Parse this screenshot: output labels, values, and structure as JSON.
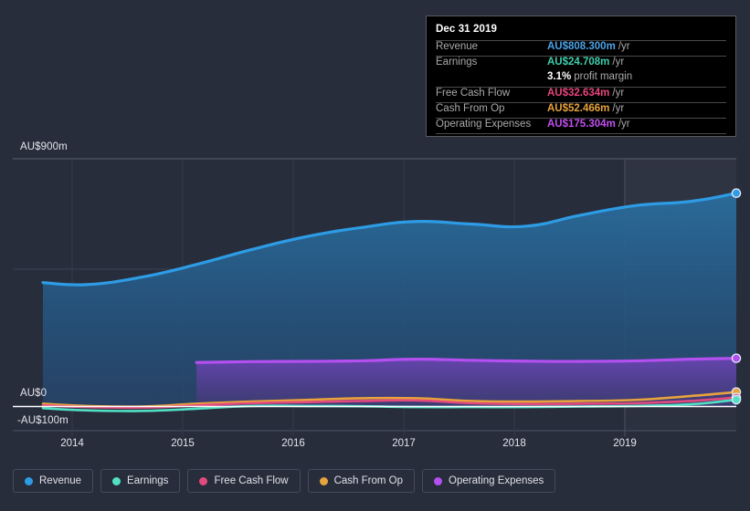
{
  "chart_data": {
    "type": "area",
    "title": "",
    "xlabel": "",
    "ylabel": "",
    "currency": "AU$",
    "x_tick_labels": [
      "2014",
      "2015",
      "2016",
      "2017",
      "2018",
      "2019"
    ],
    "y_tick_labels": [
      "AU$900m",
      "AU$0",
      "-AU$100m"
    ],
    "ylim": [
      -100,
      900
    ],
    "y_unit": "m",
    "grid": true,
    "legend_position": "bottom-left",
    "series": [
      {
        "name": "Revenue",
        "color": "#2d9ce5",
        "fill": "rgba(36,110,160,0.55)",
        "x": [
          2013.6,
          2014.0,
          2014.5,
          2015.0,
          2015.5,
          2016.0,
          2016.5,
          2017.0,
          2017.5,
          2018.0,
          2018.5,
          2019.0,
          2019.5,
          2019.92
        ],
        "values": [
          450,
          443,
          470,
          516,
          570,
          617,
          650,
          672,
          663,
          655,
          695,
          730,
          745,
          775
        ]
      },
      {
        "name": "Earnings",
        "color": "#52e0c4",
        "x": [
          2013.6,
          2014.0,
          2014.5,
          2015.0,
          2015.5,
          2016.0,
          2016.5,
          2017.0,
          2017.5,
          2018.0,
          2018.5,
          2019.0,
          2019.5,
          2019.92
        ],
        "values": [
          -6,
          -14,
          -16,
          -8,
          2,
          2,
          1,
          -2,
          -2,
          -2,
          0,
          2,
          8,
          24.708
        ]
      },
      {
        "name": "Free Cash Flow",
        "color": "#e24a7e",
        "x": [
          2013.6,
          2014.0,
          2014.5,
          2015.0,
          2015.5,
          2016.0,
          2016.5,
          2017.0,
          2017.5,
          2018.0,
          2018.5,
          2019.0,
          2019.5,
          2019.92
        ],
        "values": [
          4,
          -2,
          -4,
          4,
          12,
          16,
          20,
          22,
          12,
          9,
          10,
          12,
          20,
          32.634
        ]
      },
      {
        "name": "Cash From Op",
        "color": "#e8a33d",
        "x": [
          2013.6,
          2014.0,
          2014.5,
          2015.0,
          2015.5,
          2016.0,
          2016.5,
          2017.0,
          2017.5,
          2018.0,
          2018.5,
          2019.0,
          2019.5,
          2019.92
        ],
        "values": [
          10,
          2,
          0,
          10,
          18,
          24,
          30,
          30,
          20,
          18,
          20,
          24,
          38,
          52.466
        ]
      },
      {
        "name": "Operating Expenses",
        "color": "#b44ff0",
        "fill": "rgba(96,62,160,0.55)",
        "x": [
          2015.0,
          2015.5,
          2016.0,
          2016.5,
          2017.0,
          2017.5,
          2018.0,
          2018.5,
          2019.0,
          2019.5,
          2019.92
        ],
        "values": [
          160,
          163,
          164,
          166,
          172,
          168,
          165,
          164,
          166,
          172,
          175.304
        ]
      }
    ]
  },
  "tooltip": {
    "title": "Dec 31 2019",
    "rows": [
      {
        "key": "Revenue",
        "value": "AU$808.300m",
        "unit": "/yr",
        "color": "#4aa3e8"
      },
      {
        "key": "Earnings",
        "value": "AU$24.708m",
        "unit": "/yr",
        "color": "#3ecfad"
      },
      {
        "key": "",
        "value": "3.1%",
        "unit": "profit margin",
        "color": "#ffffff"
      },
      {
        "key": "Free Cash Flow",
        "value": "AU$32.634m",
        "unit": "/yr",
        "color": "#e8457d"
      },
      {
        "key": "Cash From Op",
        "value": "AU$52.466m",
        "unit": "/yr",
        "color": "#e8a33d"
      },
      {
        "key": "Operating Expenses",
        "value": "AU$175.304m",
        "unit": "/yr",
        "color": "#c14ff0"
      }
    ]
  },
  "legend": {
    "items": [
      {
        "label": "Revenue",
        "color": "#2d9ce5"
      },
      {
        "label": "Earnings",
        "color": "#52e0c4"
      },
      {
        "label": "Free Cash Flow",
        "color": "#e24a7e"
      },
      {
        "label": "Cash From Op",
        "color": "#e8a33d"
      },
      {
        "label": "Operating Expenses",
        "color": "#b44ff0"
      }
    ]
  },
  "axes": {
    "y_top_label": "AU$900m",
    "y_zero_label": "AU$0",
    "y_bottom_label": "-AU$100m",
    "x_labels": [
      "2014",
      "2015",
      "2016",
      "2017",
      "2018",
      "2019"
    ]
  }
}
